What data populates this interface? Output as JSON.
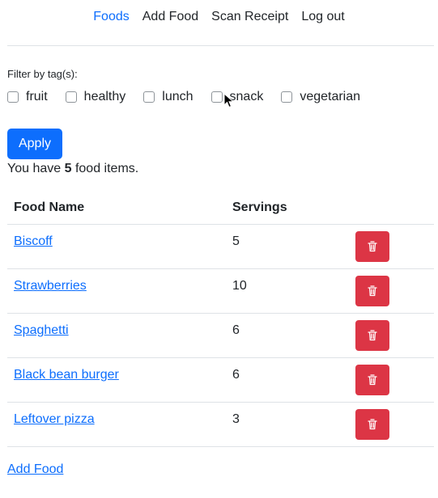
{
  "nav": {
    "foods": "Foods",
    "add_food": "Add Food",
    "scan_receipt": "Scan Receipt",
    "logout": "Log out"
  },
  "filter": {
    "label": "Filter by tag(s):",
    "tags": [
      "fruit",
      "healthy",
      "lunch",
      "snack",
      "vegetarian"
    ],
    "checked": [
      false,
      false,
      false,
      false,
      false
    ]
  },
  "apply_label": "Apply",
  "count": {
    "prefix": "You have",
    "number": "5",
    "suffix": "food items."
  },
  "table": {
    "headers": [
      "Food Name",
      "Servings"
    ],
    "rows": [
      {
        "name": "Biscoff",
        "servings": "5"
      },
      {
        "name": "Strawberries",
        "servings": "10"
      },
      {
        "name": "Spaghetti",
        "servings": "6"
      },
      {
        "name": "Black bean burger",
        "servings": "6"
      },
      {
        "name": "Leftover pizza",
        "servings": "3"
      }
    ]
  },
  "bottom_link": "Add Food",
  "colors": {
    "primary": "#0d6efd",
    "danger": "#dc3545",
    "text": "#212529",
    "divider": "#dee2e6"
  },
  "icons": {
    "delete": "trash-icon",
    "pointer": "mouse-cursor-icon"
  }
}
